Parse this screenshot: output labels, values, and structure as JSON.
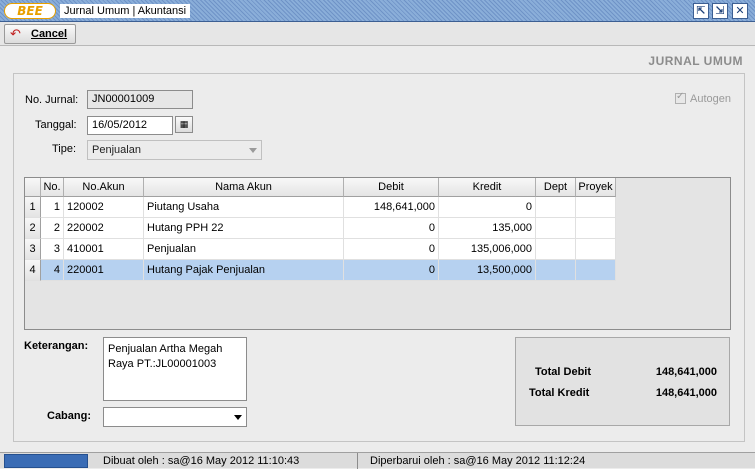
{
  "window": {
    "logo": "BEE",
    "title": "Jurnal Umum | Akuntansi",
    "restore_glyph": "⇱",
    "maximize_glyph": "⇲",
    "close_glyph": "✕"
  },
  "toolbar": {
    "cancel_label": "Cancel",
    "cancel_icon": "undo-arrow-icon"
  },
  "page_title": "JURNAL UMUM",
  "form": {
    "no_jurnal_label": "No. Jurnal:",
    "no_jurnal_value": "JN00001009",
    "tanggal_label": "Tanggal:",
    "tanggal_value": "16/05/2012",
    "tipe_label": "Tipe:",
    "tipe_value": "Penjualan",
    "autogen_label": "Autogen",
    "autogen_checked": true
  },
  "grid": {
    "headers": [
      "No.",
      "No.Akun",
      "Nama Akun",
      "Debit",
      "Kredit",
      "Dept",
      "Proyek"
    ],
    "rows": [
      {
        "idx": "1",
        "no": "1",
        "akun": "120002",
        "nama": "Piutang Usaha",
        "debit": "148,641,000",
        "kredit": "0",
        "dept": "",
        "proyek": ""
      },
      {
        "idx": "2",
        "no": "2",
        "akun": "220002",
        "nama": "Hutang PPH 22",
        "debit": "0",
        "kredit": "135,000",
        "dept": "",
        "proyek": ""
      },
      {
        "idx": "3",
        "no": "3",
        "akun": "410001",
        "nama": "Penjualan",
        "debit": "0",
        "kredit": "135,006,000",
        "dept": "",
        "proyek": ""
      },
      {
        "idx": "4",
        "no": "4",
        "akun": "220001",
        "nama": "Hutang Pajak Penjualan",
        "debit": "0",
        "kredit": "13,500,000",
        "dept": "",
        "proyek": ""
      }
    ]
  },
  "keterangan": {
    "label": "Keterangan:",
    "line1": "Penjualan Artha Megah",
    "line2": "Raya PT.:JL00001003"
  },
  "cabang": {
    "label": "Cabang:",
    "value": ""
  },
  "totals": {
    "debit_label": "Total Debit",
    "debit_value": "148,641,000",
    "kredit_label": "Total Kredit",
    "kredit_value": "148,641,000"
  },
  "status": {
    "dibuat": "Dibuat oleh : sa@16 May 2012  11:10:43",
    "diperbarui": "Diperbarui oleh : sa@16 May 2012  11:12:24"
  }
}
